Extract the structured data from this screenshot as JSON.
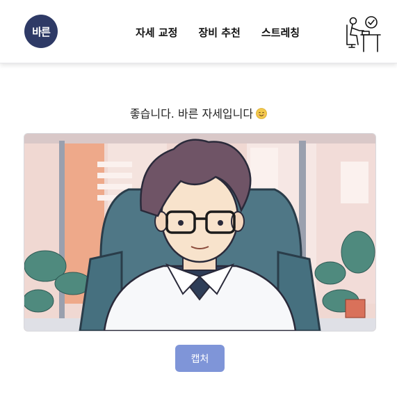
{
  "header": {
    "logo_text": "바른",
    "nav": [
      {
        "label": "자세 교정"
      },
      {
        "label": "장비 추천"
      },
      {
        "label": "스트레칭"
      }
    ],
    "desk_icon": "person-at-desk-check-icon"
  },
  "main": {
    "status_text": "좋습니다. 바른 자세입니다",
    "status_emoji": "smiling-face-icon",
    "webcam_subject": "webcam-feed",
    "capture_label": "캡처"
  },
  "colors": {
    "brand": "#2e3a66",
    "button": "#7f95d8"
  }
}
